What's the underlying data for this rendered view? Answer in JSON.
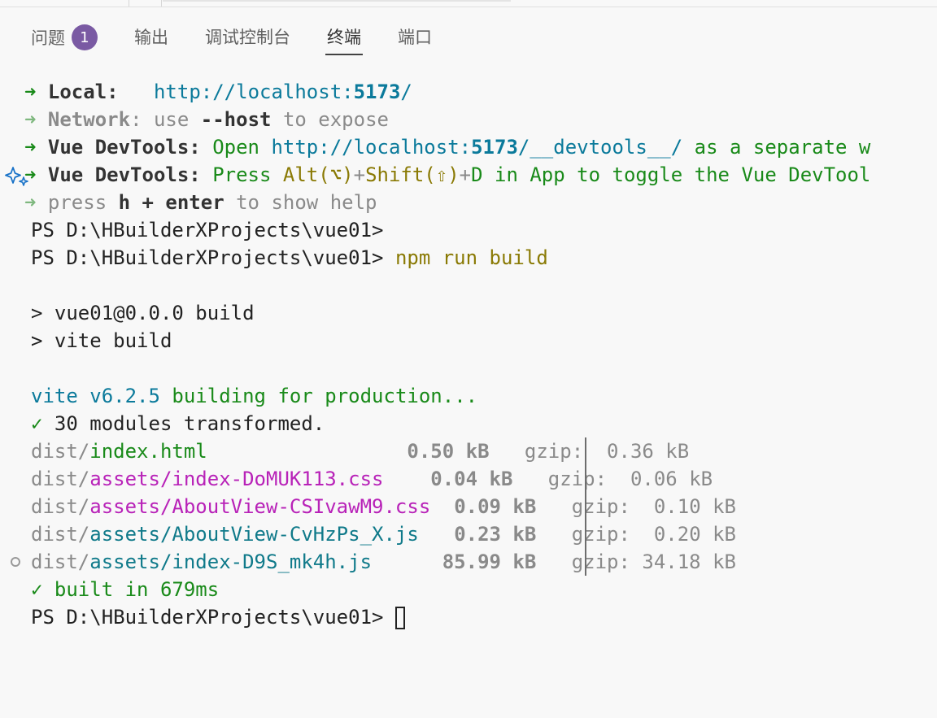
{
  "tabs": [
    {
      "label": "问题",
      "badge": "1"
    },
    {
      "label": "输出"
    },
    {
      "label": "调试控制台"
    },
    {
      "label": "终端",
      "active": true
    },
    {
      "label": "端口"
    }
  ],
  "terminal": {
    "arrow": "➜",
    "vite_lines": {
      "local_label": "Local:",
      "local_url_prefix": "http://localhost:",
      "local_port": "5173",
      "local_url_suffix": "/",
      "network_label": "Network",
      "network_colon": ":",
      "network_use": "use",
      "network_host": "--host",
      "network_expose": "to expose",
      "devtools_label": "Vue DevTools",
      "devtools_colon": ":",
      "devtools1_open": "Open",
      "devtools1_url_prefix": "http://localhost:",
      "devtools1_port": "5173",
      "devtools1_url_suffix": "/__devtools__/",
      "devtools1_tail": "as a separate w",
      "devtools2_press": "Press",
      "devtools2_alt": "Alt(⌥)",
      "devtools2_plus1": "+",
      "devtools2_shift": "Shift(⇧)",
      "devtools2_plus2": "+",
      "devtools2_tail": "D in App to toggle the Vue DevTool",
      "help_press": "press",
      "help_keys": "h + enter",
      "help_tail": "to show help"
    },
    "prompt": "PS D:\\HBuilderXProjects\\vue01>",
    "command": "npm run build",
    "script_line1": "> vue01@0.0.0 build",
    "script_line2": "> vite build",
    "vite_version": "vite v6.2.5",
    "building": "building for production...",
    "check": "✓",
    "modules": "30 modules transformed.",
    "files": [
      {
        "dir": "dist/",
        "name": "index.html",
        "kind": "html",
        "size": "0.50 kB",
        "gzip": "gzip:  0.36 kB"
      },
      {
        "dir": "dist/",
        "name": "assets/index-DoMUK113.css",
        "kind": "css",
        "size": "0.04 kB",
        "gzip": "gzip:  0.06 kB"
      },
      {
        "dir": "dist/",
        "name": "assets/AboutView-CSIvawM9.css",
        "kind": "css",
        "size": "0.09 kB",
        "gzip": "gzip:  0.10 kB"
      },
      {
        "dir": "dist/",
        "name": "assets/AboutView-CvHzPs_X.js",
        "kind": "js",
        "size": "0.23 kB",
        "gzip": "gzip:  0.20 kB"
      },
      {
        "dir": "dist/",
        "name": "assets/index-D9S_mk4h.js",
        "kind": "js",
        "size": "85.99 kB",
        "gzip": "gzip: 34.18 kB"
      }
    ],
    "built": "built in 679ms"
  },
  "colors": {
    "background": "#f8f8f8",
    "green": "#198a19",
    "cyan": "#0b7a9b",
    "magenta": "#b822b8",
    "grey": "#8a8a8a",
    "badge": "#7a5aa3"
  },
  "icons": {
    "sparkle": "sparkle-icon",
    "circle": "circle-decoration-icon"
  }
}
